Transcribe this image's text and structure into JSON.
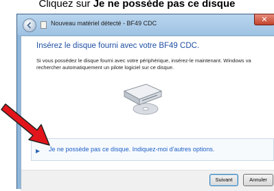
{
  "caption": {
    "prefix": "Cliquez sur ",
    "bold": "Je ne possède pas ce disque"
  },
  "window": {
    "title": "Nouveau matériel détecté - BF49 CDC",
    "close_glyph": "✕"
  },
  "content": {
    "heading": "Insérez le disque fourni avec votre BF49 CDC.",
    "body": "Si vous possédez le disque fourni avec votre périphérique, insérez-le maintenant. Windows va rechercher automatiquement un pilote logiciel sur ce disque.",
    "option": {
      "arrow": "▶",
      "text": "Je ne possède pas ce disque. Indiquez-moi d'autres options."
    }
  },
  "buttons": {
    "next": "Suivant",
    "cancel": "Annuler"
  },
  "colors": {
    "heading": "#1f4fa3",
    "link": "#1b5ec7",
    "annotation_arrow": "#e3151c"
  },
  "icons": [
    "back-arrow-icon",
    "hardware-icon",
    "cd-drive-icon",
    "annotation-arrow-icon"
  ]
}
